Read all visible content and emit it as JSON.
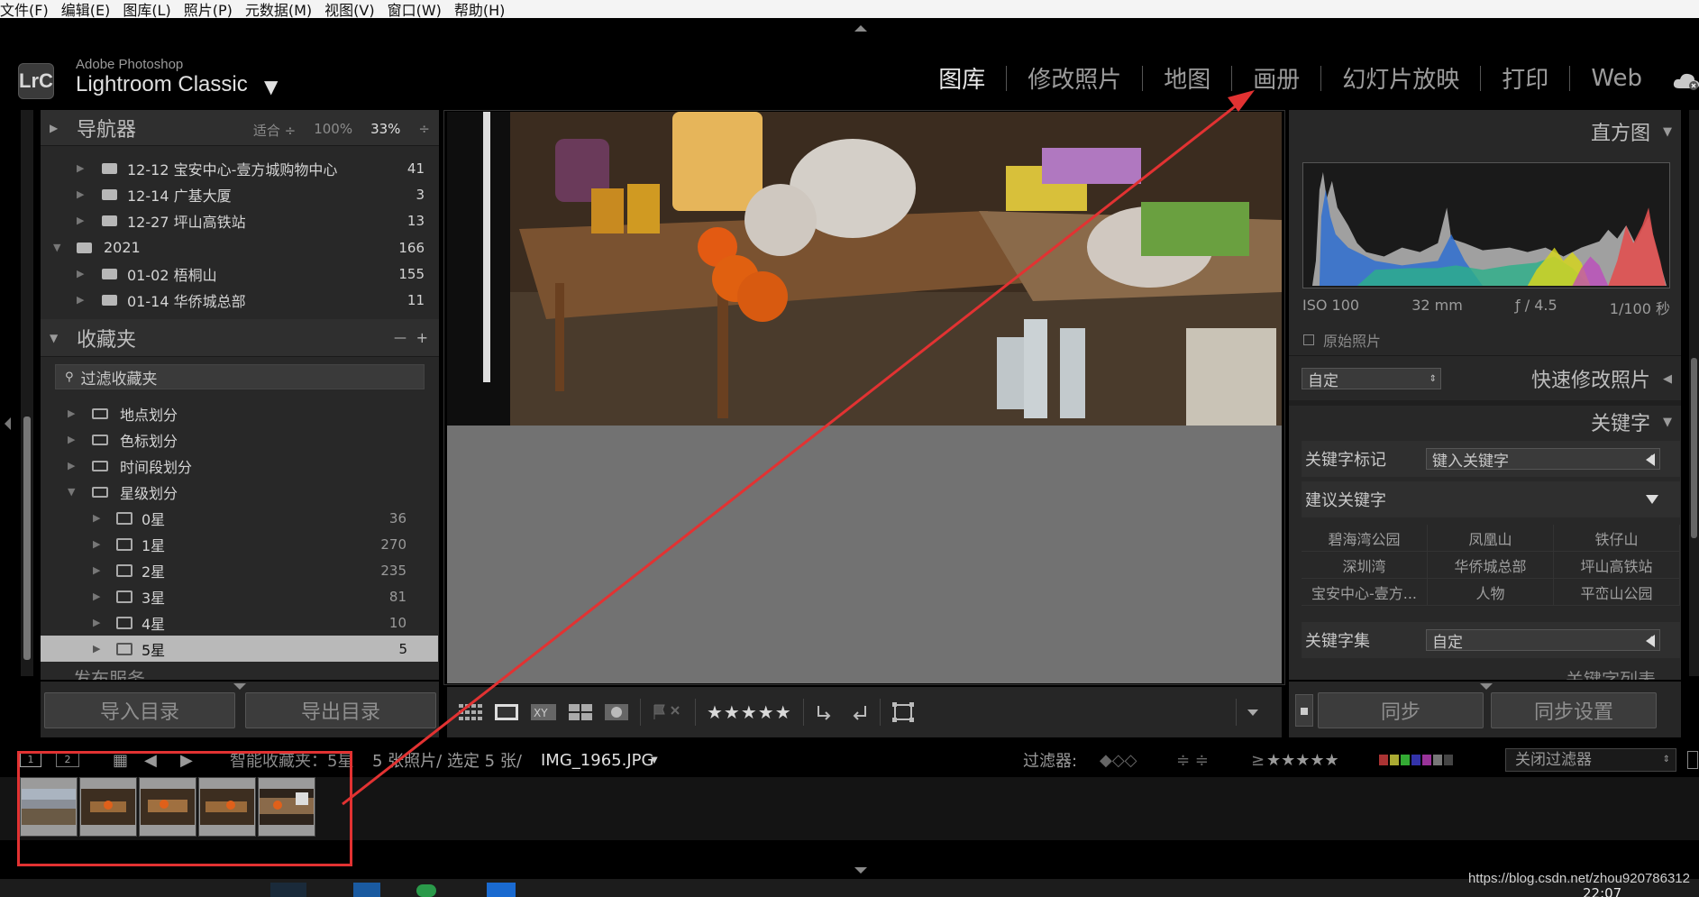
{
  "menubar": [
    "文件(F)",
    "编辑(E)",
    "图库(L)",
    "照片(P)",
    "元数据(M)",
    "视图(V)",
    "窗口(W)",
    "帮助(H)"
  ],
  "identity": {
    "badge": "LrC",
    "vendor": "Adobe Photoshop",
    "app": "Lightroom Classic",
    "caret": "▼"
  },
  "modules": [
    "图库",
    "修改照片",
    "地图",
    "画册",
    "幻灯片放映",
    "打印",
    "Web"
  ],
  "navigator": {
    "title": "导航器",
    "fit": "适合 ÷",
    "p100": "100%",
    "p33": "33%",
    "spin": "÷"
  },
  "folders": [
    {
      "label": "12-12 宝安中心-壹方城购物中心",
      "count": "41"
    },
    {
      "label": "12-14 广基大厦",
      "count": "3"
    },
    {
      "label": "12-27 坪山高铁站",
      "count": "13"
    },
    {
      "label": "2021",
      "count": "166"
    },
    {
      "label": "01-02 梧桐山",
      "count": "155"
    },
    {
      "label": "01-14 华侨城总部",
      "count": "11"
    }
  ],
  "collections": {
    "title": "收藏夹",
    "minus": "—",
    "plus": "+",
    "filter": "过滤收藏夹",
    "sets": [
      "地点划分",
      "色标划分",
      "时间段划分",
      "星级划分"
    ],
    "stars": [
      {
        "label": "0星",
        "count": "36"
      },
      {
        "label": "1星",
        "count": "270"
      },
      {
        "label": "2星",
        "count": "235"
      },
      {
        "label": "3星",
        "count": "81"
      },
      {
        "label": "4星",
        "count": "10"
      },
      {
        "label": "5星",
        "count": "5"
      }
    ],
    "publish": "发布服务"
  },
  "buttons": {
    "import": "导入目录",
    "export": "导出目录",
    "sync": "同步",
    "sync_settings": "同步设置"
  },
  "toolbar": {
    "stars": "★★★★★"
  },
  "right": {
    "histogram": "直方图",
    "iso": "ISO 100",
    "focal": "32 mm",
    "aperture": "ƒ / 4.5",
    "shutter": "1/100 秒",
    "original": "原始照片",
    "preset": "自定",
    "quick_develop": "快速修改照片",
    "keywords": "关键字",
    "kw_tag_label": "关键字标记",
    "kw_tag_input": "键入关键字",
    "suggested": "建议关键字",
    "suggested_list": [
      "碧海湾公园",
      "凤凰山",
      "铁仔山",
      "深圳湾",
      "华侨城总部",
      "坪山高铁站",
      "宝安中心-壹方...",
      "人物",
      "平峦山公园"
    ],
    "kw_set_label": "关键字集",
    "kw_set_value": "自定",
    "kw_list": "关键字列表"
  },
  "filmstrip": {
    "view1": "1",
    "view2": "2",
    "source": "智能收藏夹：5星",
    "counts": "5 张照片/ 选定 5 张/",
    "filename": "IMG_1965.JPG",
    "filter_label": "过滤器:",
    "gte": "≥",
    "filter_stars": "★★★★★",
    "filter_off": "关闭过滤器"
  },
  "url": "https://blog.csdn.net/zhou920786312",
  "clock": "22:07",
  "colors": {
    "annotation_red": "#e23232",
    "panel": "#282828",
    "selected_row": "#b9b9b9"
  }
}
